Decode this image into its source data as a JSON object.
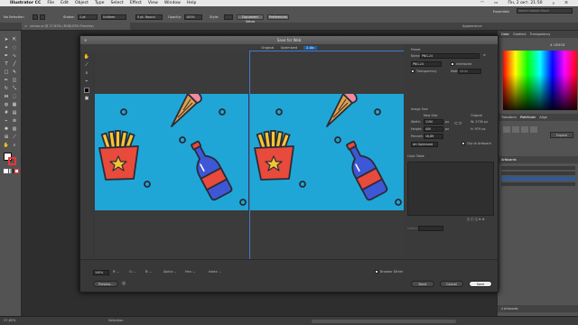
{
  "menubar": {
    "app_name": "Illustrator CC",
    "items": [
      "File",
      "Edit",
      "Object",
      "Type",
      "Select",
      "Effect",
      "View",
      "Window",
      "Help"
    ],
    "clock": "Пн, 2 окт. 21:50"
  },
  "control_bar": {
    "selection": "No Selection",
    "stroke_label": "Stroke:",
    "stroke_value": "1 pt",
    "brush": "Uniform",
    "profile": "5 pt. Round",
    "opacity_label": "Opacity:",
    "opacity_value": "100%",
    "style_label": "Style:",
    "document_setup": "Document Setup",
    "preferences": "Preferences",
    "workspace": "Essentials",
    "search_placeholder": "Search Adobe Stock"
  },
  "doc_tab": {
    "label": "vector.ai @ 27,83% (RGB/GPU Preview)"
  },
  "dialog": {
    "title": "Save for Web",
    "tabs": [
      "Original",
      "Optimized",
      "2-Up"
    ],
    "active_tab": "2-Up",
    "left_pane": {
      "line1": "Original: \"vector.ai\"",
      "line2": "2,65M"
    },
    "right_pane": {
      "line1": "PNG-24",
      "line2": "80,8%"
    },
    "settings": {
      "preset_label": "Preset",
      "name_label": "Name:",
      "name_value": "PNG-24",
      "format_value": "PNG-24",
      "interlaced_label": "Interlaced",
      "transparency_label": "Transparency",
      "matte_label": "Matte:",
      "matte_value": "White",
      "image_size_label": "Image Size",
      "new_size_label": "New Size",
      "original_label": "Original",
      "width_label": "Width:",
      "width_value": "1190",
      "height_label": "Height:",
      "height_value": "400",
      "px_unit": "px",
      "orig_w": "W: 2700 px",
      "orig_h": "H: 979 px",
      "percent_label": "Percent:",
      "percent_value": "16,89",
      "clip_label": "Clip to Artboard",
      "art_optimized": "Art Optimized",
      "color_table_label": "Color Table",
      "colors_label": "Colors:"
    },
    "bottom": {
      "zoom": "100%",
      "r_label": "R: --",
      "g_label": "G: --",
      "b_label": "B: --",
      "alpha_label": "Alpha: --",
      "hex_label": "Hex: --",
      "index_label": "Index: --",
      "browser_dither": "Browser Dither",
      "preview_button": "Preview...",
      "done_button": "Done",
      "cancel_button": "Cancel",
      "save_button": "Save"
    }
  },
  "right_panels": {
    "tabs": [
      "Appearance",
      "Color",
      "Gradient",
      "Transparency"
    ],
    "hex_value": "1B5ECB",
    "pathfinder_tabs": [
      "Transform",
      "Pathfinder",
      "Align"
    ],
    "expand_label": "Expand",
    "artboards_tab": "Artboards",
    "artboards_count": "4 Artboards"
  },
  "status": {
    "zoom": "27,83%",
    "mode": "Selection"
  },
  "colors": {
    "artboard_bg": "#1fa6d6",
    "outline": "#2b2b36",
    "fries_box": "#e84a3c",
    "fries": "#f7c533",
    "bottle": "#3e57d6",
    "label": "#e84a3c",
    "cone": "#e0a04a",
    "icecream": "#f08aa0",
    "accent": "#1f5fa8"
  }
}
